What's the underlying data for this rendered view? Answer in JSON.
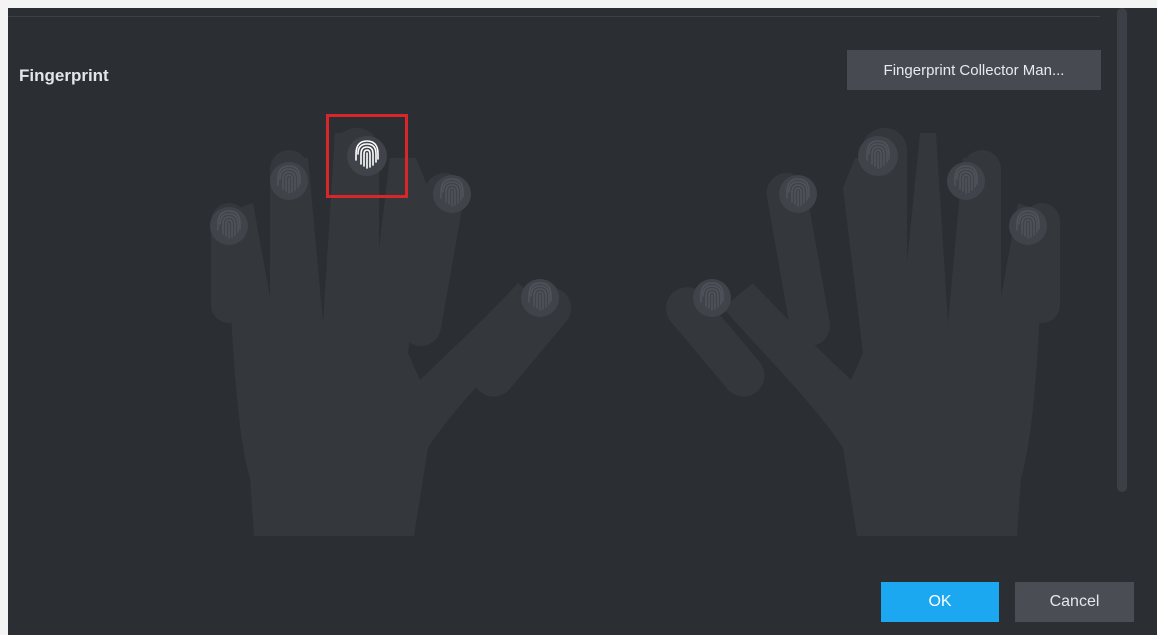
{
  "dialog": {
    "title": "Fingerprint",
    "collector_button_label": "Fingerprint Collector Man...",
    "ok_label": "OK",
    "cancel_label": "Cancel"
  },
  "colors": {
    "dialog_background": "#2b2e33",
    "hand": "#34383d",
    "fingertip": "#4a4e54",
    "selected_fingertip": "#ffffff",
    "selection_border": "#d9262b",
    "ok_button": "#1ba8f0",
    "cancel_button": "#4a4e54"
  },
  "hands": {
    "left": {
      "fingers": [
        "pinky",
        "ring",
        "middle",
        "index",
        "thumb"
      ],
      "selected_finger": "middle"
    },
    "right": {
      "fingers": [
        "thumb",
        "index",
        "middle",
        "ring",
        "pinky"
      ]
    }
  },
  "icons": {
    "fingerprint": "fingerprint-icon",
    "scrollbar": "scrollbar-thumb"
  }
}
